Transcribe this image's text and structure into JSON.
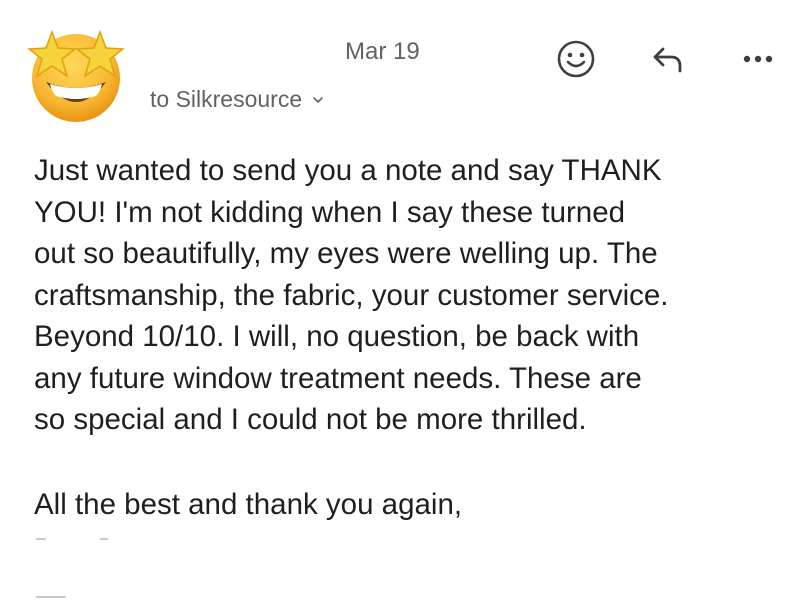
{
  "message": {
    "date": "Mar 19",
    "recipient": "to Silkresource",
    "body": "Just wanted to send you a note and say THANK\nYOU! I'm not kidding when I say these turned\nout so beautifully, my eyes were welling up. The\ncraftsmanship, the fabric, your customer service.\nBeyond 10/10. I will, no question, be back with\nany future window treatment needs. These are\nso special and I could not be more thrilled.",
    "closing": "All the best and thank you again,"
  },
  "icons": {
    "avatar": "star-struck-emoji-icon",
    "recipient_expand": "chevron-down-icon",
    "emoji_react": "smiley-icon",
    "reply": "reply-arrow-icon",
    "more": "more-horizontal-icon"
  },
  "colors": {
    "text": "#1f1f1f",
    "secondary_text": "#5f6368",
    "emoji_face": "#f7b731",
    "emoji_star": "#f6d23b"
  }
}
